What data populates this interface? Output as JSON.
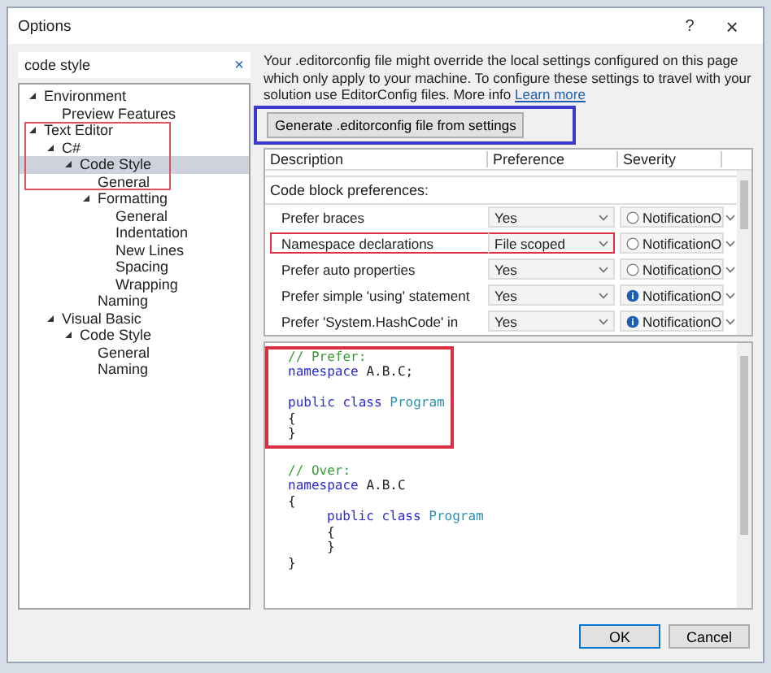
{
  "window": {
    "title": "Options",
    "help": "?",
    "close": "×"
  },
  "search": {
    "value": "code style",
    "clear": "×"
  },
  "tree": [
    {
      "label": "Environment",
      "expanded": true,
      "selected": false,
      "highlighted": false,
      "children": [
        {
          "label": "Preview Features",
          "selected": false,
          "highlighted": false
        }
      ]
    },
    {
      "label": "Text Editor",
      "expanded": true,
      "selected": false,
      "highlighted": true,
      "children": [
        {
          "label": "C#",
          "expanded": true,
          "selected": false,
          "highlighted": true,
          "children": [
            {
              "label": "Code Style",
              "expanded": true,
              "selected": true,
              "highlighted": true,
              "children": [
                {
                  "label": "General",
                  "selected": false,
                  "highlighted": true
                },
                {
                  "label": "Formatting",
                  "expanded": true,
                  "selected": false,
                  "highlighted": false,
                  "children": [
                    {
                      "label": "General",
                      "selected": false,
                      "highlighted": false
                    },
                    {
                      "label": "Indentation",
                      "selected": false,
                      "highlighted": false
                    },
                    {
                      "label": "New Lines",
                      "selected": false,
                      "highlighted": false
                    },
                    {
                      "label": "Spacing",
                      "selected": false,
                      "highlighted": false
                    },
                    {
                      "label": "Wrapping",
                      "selected": false,
                      "highlighted": false
                    }
                  ]
                },
                {
                  "label": "Naming",
                  "selected": false,
                  "highlighted": false
                }
              ]
            }
          ]
        },
        {
          "label": "Visual Basic",
          "expanded": true,
          "selected": false,
          "highlighted": false,
          "children": [
            {
              "label": "Code Style",
              "expanded": true,
              "selected": false,
              "highlighted": false,
              "children": [
                {
                  "label": "General",
                  "selected": false,
                  "highlighted": false
                },
                {
                  "label": "Naming",
                  "selected": false,
                  "highlighted": false
                }
              ]
            }
          ]
        }
      ]
    }
  ],
  "info": {
    "text": "Your .editorconfig file might override the local settings configured on this page which only apply to your machine. To configure these settings to travel with your solution use EditorConfig files. More info",
    "link": "Learn more"
  },
  "generate_button": {
    "label": "Generate .editorconfig file from settings",
    "highlighted": true
  },
  "table": {
    "columns": [
      "Description",
      "Preference",
      "Severity"
    ],
    "group": "Code block preferences:",
    "rows": [
      {
        "description": "Prefer braces",
        "preference": "Yes",
        "severity": "NotificationO",
        "severity_info": false,
        "highlighted": false
      },
      {
        "description": "Namespace declarations",
        "preference": "File scoped",
        "severity": "NotificationO",
        "severity_info": false,
        "highlighted": true
      },
      {
        "description": "Prefer auto properties",
        "preference": "Yes",
        "severity": "NotificationO",
        "severity_info": false,
        "highlighted": false
      },
      {
        "description": "Prefer simple 'using' statement",
        "preference": "Yes",
        "severity": "NotificationO",
        "severity_info": true,
        "highlighted": false
      },
      {
        "description": "Prefer 'System.HashCode' in",
        "preference": "Yes",
        "severity": "NotificationO",
        "severity_info": true,
        "highlighted": false
      }
    ]
  },
  "code_preview": [
    {
      "highlighted": true,
      "lines": [
        {
          "indented": false,
          "tokens": [
            {
              "kind": "comment",
              "text": "// Prefer:"
            }
          ]
        },
        {
          "indented": false,
          "tokens": [
            {
              "kind": "keyword",
              "text": "namespace"
            },
            {
              "kind": "plain",
              "text": "A.B.C;"
            }
          ]
        },
        {
          "indented": false,
          "gap_before": true,
          "tokens": [
            {
              "kind": "keyword",
              "text": "public class"
            },
            {
              "kind": "type",
              "text": "Program"
            }
          ]
        },
        {
          "indented": false,
          "tokens": [
            {
              "kind": "plain",
              "text": "{"
            }
          ]
        },
        {
          "indented": false,
          "tokens": [
            {
              "kind": "plain",
              "text": "}"
            }
          ]
        }
      ]
    },
    {
      "highlighted": false,
      "lines": [
        {
          "indented": false,
          "tokens": [
            {
              "kind": "comment",
              "text": "// Over:"
            }
          ]
        },
        {
          "indented": false,
          "tokens": [
            {
              "kind": "keyword",
              "text": "namespace"
            },
            {
              "kind": "plain",
              "text": "A.B.C"
            }
          ]
        },
        {
          "indented": false,
          "tokens": [
            {
              "kind": "plain",
              "text": "{"
            }
          ]
        },
        {
          "indented": true,
          "tokens": [
            {
              "kind": "keyword",
              "text": "public class"
            },
            {
              "kind": "type",
              "text": "Program"
            }
          ]
        },
        {
          "indented": true,
          "tokens": [
            {
              "kind": "plain",
              "text": "{"
            }
          ]
        },
        {
          "indented": true,
          "tokens": [
            {
              "kind": "plain",
              "text": "}"
            }
          ]
        },
        {
          "indented": false,
          "tokens": [
            {
              "kind": "plain",
              "text": "}"
            }
          ]
        }
      ]
    }
  ],
  "buttons": [
    {
      "label": "OK",
      "default": true
    },
    {
      "label": "Cancel",
      "default": false
    }
  ]
}
